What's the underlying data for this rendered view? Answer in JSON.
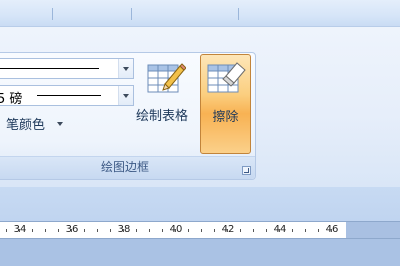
{
  "ribbon": {
    "group_title": "绘图边框",
    "line_weight": {
      "number_fragment": "5",
      "unit": "磅"
    },
    "pen_color_label": "笔颜色",
    "draw_table_label": "绘制表格",
    "erase_label": "擦除"
  },
  "ruler": {
    "numbers": [
      "34",
      "36",
      "38",
      "40",
      "42",
      "44",
      "46"
    ]
  },
  "colors": {
    "active_button": "#f8b253",
    "ribbon_background": "#e6eefa",
    "group_label_text": "#3d5a86"
  },
  "icons": {
    "draw_table": "table-pencil-icon",
    "erase": "table-eraser-icon",
    "dialog_launcher": "dialog-launcher-icon"
  }
}
